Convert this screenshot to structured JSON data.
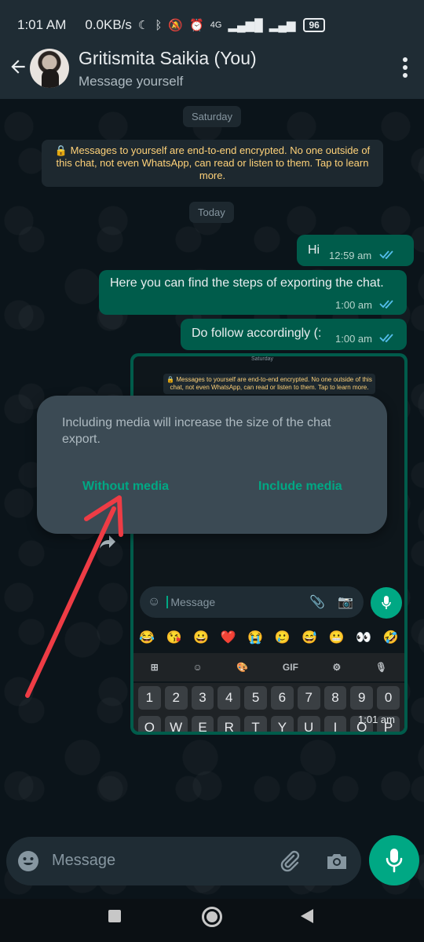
{
  "status_bar": {
    "time": "1:01 AM",
    "speed": "0.0KB/s",
    "network_label": "4G",
    "battery": "96"
  },
  "header": {
    "contact_name": "Gritismita Saikia (You)",
    "subtitle": "Message yourself"
  },
  "chat": {
    "date_chip_1": "Saturday",
    "encryption_notice": "🔒 Messages to yourself are end-to-end encrypted. No one outside of this chat, not even WhatsApp, can read or listen to them. Tap to learn more.",
    "date_chip_2": "Today",
    "messages": [
      {
        "text": "Hi",
        "time": "12:59 am"
      },
      {
        "text": "Here you can find the steps of exporting the chat.",
        "time": "1:00 am"
      },
      {
        "text": "Do follow accordingly (:",
        "time": "1:00 am"
      }
    ],
    "image_message": {
      "time": "1:01 am",
      "mini_date": "Saturday",
      "mini_notice": "🔒 Messages to yourself are end-to-end encrypted. No one outside of this chat, not even WhatsApp, can read or listen to them. Tap to learn more.",
      "mini_input_placeholder": "Message",
      "emojis": [
        "😂",
        "😘",
        "😀",
        "❤️",
        "😭",
        "🥲",
        "😅",
        "😬",
        "👀",
        "🤣"
      ],
      "gif_label": "GIF",
      "number_keys": [
        "1",
        "2",
        "3",
        "4",
        "5",
        "6",
        "7",
        "8",
        "9",
        "0"
      ],
      "letter_keys": [
        "Q",
        "W",
        "E",
        "R",
        "T",
        "Y",
        "U",
        "I",
        "O",
        "P"
      ]
    }
  },
  "dialog": {
    "message": "Including media will increase the size of the chat export.",
    "without_media": "Without media",
    "include_media": "Include media"
  },
  "input": {
    "placeholder": "Message"
  },
  "colors": {
    "accent": "#00a884",
    "outgoing_bubble": "#005c4b",
    "dialog_bg": "#3b4a54",
    "annotation_arrow": "#ee3c45"
  }
}
